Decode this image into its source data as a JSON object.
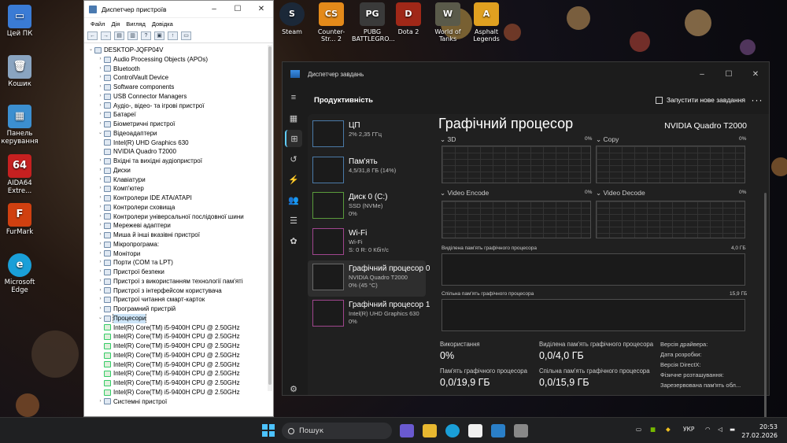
{
  "desktop_icons": [
    {
      "label": "Цей ПК",
      "icon": "this-pc-icon"
    },
    {
      "label": "Кошик",
      "icon": "recycle-bin-icon"
    },
    {
      "label": "Панель керування",
      "icon": "control-panel-icon"
    },
    {
      "label": "AIDA64 Extre...",
      "icon": "aida64-icon"
    },
    {
      "label": "FurMark",
      "icon": "furmark-icon"
    },
    {
      "label": "Microsoft Edge",
      "icon": "edge-icon"
    }
  ],
  "game_icons": [
    {
      "label": "Steam",
      "icon": "steam-icon"
    },
    {
      "label": "Counter-Str... 2",
      "icon": "cs2-icon"
    },
    {
      "label": "PUBG BATTLEGRO...",
      "icon": "pubg-icon"
    },
    {
      "label": "Dota 2",
      "icon": "dota2-icon"
    },
    {
      "label": "World of Tanks",
      "icon": "wot-icon"
    },
    {
      "label": "Asphalt Legends",
      "icon": "asphalt-icon"
    }
  ],
  "devmgr": {
    "title": "Диспетчер пристроїв",
    "menu": [
      "Файл",
      "Дія",
      "Вигляд",
      "Довідка"
    ],
    "root": "DESKTOP-JQFP04V",
    "nodes": [
      "Audio Processing Objects (APOs)",
      "Bluetooth",
      "ControlVault Device",
      "Software components",
      "USB Connector Managers",
      "Аудіо-, відео- та ігрові пристрої",
      "Батареї",
      "Біометричні пристрої",
      "Відеоадаптери",
      "Intel(R) UHD Graphics 630",
      "NVIDIA Quadro T2000",
      "Вхідні та вихідні аудіопристрої",
      "Диски",
      "Клавіатури",
      "Комп'ютер",
      "Контролери IDE ATA/ATAPI",
      "Контролери сховища",
      "Контролери універсальної послідовної шини",
      "Мережеві адаптери",
      "Миша й інші вказівні пристрої",
      "Мікропрограма:",
      "Монітори",
      "Порти (COM та LPT)",
      "Пристрої безпеки",
      "Пристрої з використанням технології пам'яті",
      "Пристрої з інтерфейсом користувача",
      "Пристрої читання смарт-карток",
      "Програмний пристрій",
      "Процесори",
      "Intel(R) Core(TM) i5-9400H CPU @ 2.50GHz",
      "Intel(R) Core(TM) i5-9400H CPU @ 2.50GHz",
      "Intel(R) Core(TM) i5-9400H CPU @ 2.50GHz",
      "Intel(R) Core(TM) i5-9400H CPU @ 2.50GHz",
      "Intel(R) Core(TM) i5-9400H CPU @ 2.50GHz",
      "Intel(R) Core(TM) i5-9400H CPU @ 2.50GHz",
      "Intel(R) Core(TM) i5-9400H CPU @ 2.50GHz",
      "Intel(R) Core(TM) i5-9400H CPU @ 2.50GHz",
      "Системні пристрої"
    ]
  },
  "taskmgr": {
    "title": "Диспетчер завдань",
    "section": "Продуктивність",
    "new_task": "Запустити нове завдання",
    "perf_items": [
      {
        "t1": "ЦП",
        "t2": "2% 2,35 ГГц",
        "t3": ""
      },
      {
        "t1": "Пам'ять",
        "t2": "4,5/31,8 ГБ (14%)",
        "t3": ""
      },
      {
        "t1": "Диск 0 (C:)",
        "t2": "SSD (NVMe)",
        "t3": "0%"
      },
      {
        "t1": "Wi-Fi",
        "t2": "Wi-Fi",
        "t3": "S: 0 R: 0 Кбіт/с"
      },
      {
        "t1": "Графічний процесор 0",
        "t2": "NVIDIA Quadro T2000",
        "t3": "0% (45 °C)"
      },
      {
        "t1": "Графічний процесор 1",
        "t2": "Intel(R) UHD Graphics 630",
        "t3": "0%"
      }
    ],
    "gpu_title": "Графічний процесор",
    "gpu_name": "NVIDIA Quadro T2000",
    "engines": [
      {
        "label": "3D",
        "pct": "0%"
      },
      {
        "label": "Copy",
        "pct": "0%"
      },
      {
        "label": "Video Encode",
        "pct": "0%"
      },
      {
        "label": "Video Decode",
        "pct": "0%"
      }
    ],
    "dedicated_mem_label": "Виділена пам'ять графічного процесора",
    "dedicated_mem_max": "4,0 ГБ",
    "shared_mem_label": "Спільна пам'ять графічного процесора",
    "shared_mem_max": "15,9 ГБ",
    "stats": {
      "usage_label": "Використання",
      "usage_value": "0%",
      "ded_label": "Виділена пам'ять графічного процесора",
      "ded_value": "0,0/4,0 ГБ",
      "gpu_mem_label": "Пам'ять графічного процесора",
      "gpu_mem_value": "0,0/19,9 ГБ",
      "shared_label": "Спільна пам'ять графічного процесора",
      "shared_value": "0,0/15,9 ГБ"
    },
    "details": [
      "Версія драйвера:",
      "Дата розробки:",
      "Версія DirectX:",
      "Фізичне розташування:",
      "Зарезервована пам'ять обл..."
    ]
  },
  "taskbar": {
    "search": "Пошук",
    "lang": "УКР",
    "time": "20:53",
    "date": "27.02.2026"
  }
}
